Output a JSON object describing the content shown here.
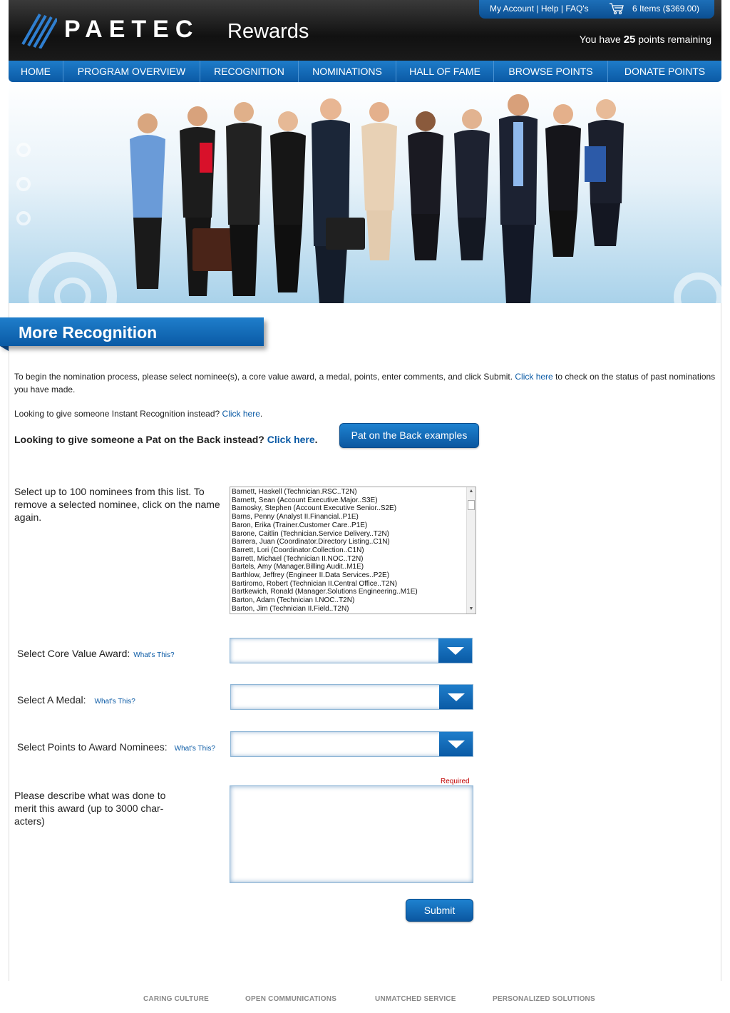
{
  "header": {
    "logo_text": "PAETEC",
    "rewards_text": "Rewards",
    "top_links": [
      "My Account",
      "Help",
      "FAQ's"
    ],
    "link_separator": " | ",
    "cart_text": "6 Items ($369.00)",
    "points_prefix": "You have ",
    "points_value": "25",
    "points_suffix": " points remaining"
  },
  "nav": {
    "items": [
      "HOME",
      "PROGRAM OVERVIEW",
      "RECOGNITION",
      "NOMINATIONS",
      "HALL OF FAME",
      "BROWSE POINTS",
      "DONATE POINTS"
    ]
  },
  "section": {
    "title": "More Recognition"
  },
  "intro": {
    "text_before": "To begin the nomination process, please select nominee(s), a core value award, a medal, points, enter comments, and click Submit. ",
    "link": "Click here",
    "text_after": " to check on the status of past nominations you have made."
  },
  "instant": {
    "text": "Looking to give someone Instant Recognition instead? ",
    "link": "Click here",
    "end": "."
  },
  "pat": {
    "text": "Looking to give someone a Pat on the Back instead? ",
    "link": "Click here",
    "end": ".",
    "button": "Pat on the Back examples"
  },
  "nominees": {
    "label": "Select up to 100 nominees from this list. To remove a selected nominee, click on the name again.",
    "items": [
      "Barnett, Haskell (Technician.RSC..T2N)",
      "Barnett, Sean (Account Executive.Major..S3E)",
      "Barnosky, Stephen (Account Executive Senior..S2E)",
      "Barns, Penny (Analyst II.Financial..P1E)",
      "Baron, Erika (Trainer.Customer Care..P1E)",
      "Barone, Caitlin (Technician.Service Delivery..T2N)",
      "Barrera, Juan (Coordinator.Directory Listing..C1N)",
      "Barrett, Lori (Coordinator.Collection..C1N)",
      "Barrett, Michael (Technician II.NOC..T2N)",
      "Bartels, Amy (Manager.Billing Audit..M1E)",
      "Barthlow, Jeffrey (Engineer II.Data Services..P2E)",
      "Bartiromo, Robert (Technician II.Central Office..T2N)",
      "Bartkewich, Ronald (Manager.Solutions Engineering..M1E)",
      "Barton, Adam (Technician I.NOC..T2N)",
      "Barton, Jim (Technician II.Field..T2N)"
    ]
  },
  "fields": {
    "core_value_label": "Select Core Value Award:",
    "medal_label": "Select A Medal:",
    "points_label": "Select Points to Award Nominees:",
    "whats_this": "What's This?",
    "core_value_selected": "",
    "medal_selected": "",
    "points_selected": ""
  },
  "description": {
    "label": "Please describe what was done to merit this award (up to 3000 char-acters)",
    "required": "Required",
    "value": ""
  },
  "submit_label": "Submit",
  "footer": [
    "CARING CULTURE",
    "OPEN COMMUNICATIONS",
    "UNMATCHED SERVICE",
    "PERSONALIZED SOLUTIONS"
  ],
  "colors": {
    "brand_blue": "#0b5aa5",
    "header_dark": "#111111",
    "required_red": "#c00000"
  }
}
